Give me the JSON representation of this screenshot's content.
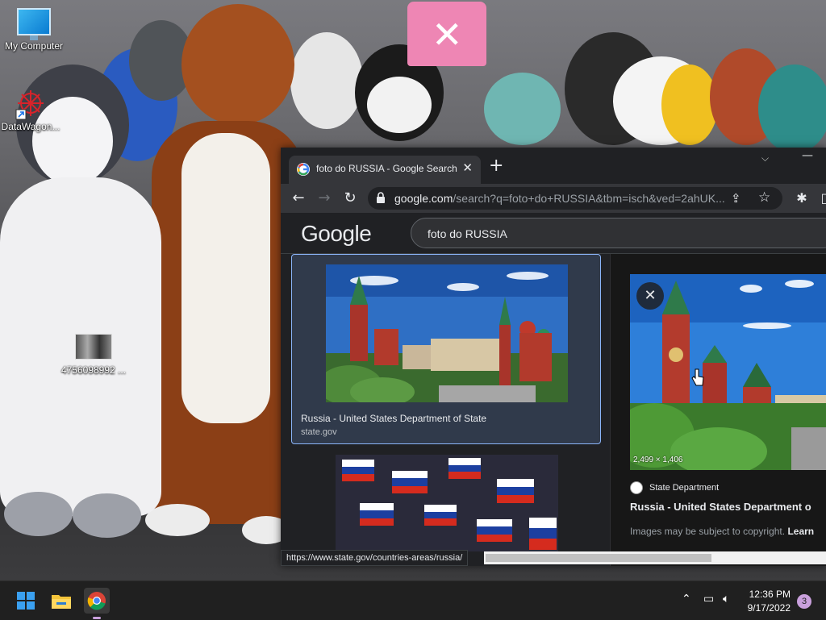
{
  "desktop": {
    "icons": [
      {
        "label": "My Computer"
      },
      {
        "label": "DataWagon..."
      },
      {
        "label": "4756098992 ..."
      }
    ]
  },
  "browser": {
    "tab": {
      "title": "foto do RUSSIA - Google Search",
      "close": "✕"
    },
    "new_tab": "+",
    "omnibox": {
      "domain": "google.com",
      "path": "/search?q=foto+do+RUSSIA&tbm=isch&ved=2ahUK..."
    },
    "page": {
      "logo": "Google",
      "search_query": "foto do RUSSIA",
      "result1": {
        "title": "Russia - United States Department of State",
        "domain": "state.gov"
      },
      "preview": {
        "dimensions": "2,499 × 1,406",
        "source": "State Department",
        "title": "Russia - United States Department o",
        "copyright": "Images may be subject to copyright.",
        "learn_more": "Learn"
      }
    },
    "status_url": "https://www.state.gov/countries-areas/russia/"
  },
  "taskbar": {
    "time": "12:36 PM",
    "date": "9/17/2022",
    "notifications": "3"
  },
  "colors": {
    "chrome_bg": "#202124",
    "chrome_toolbar": "#35363a",
    "selection_border": "#8ab4f8",
    "taskbar_bg": "#202020"
  }
}
